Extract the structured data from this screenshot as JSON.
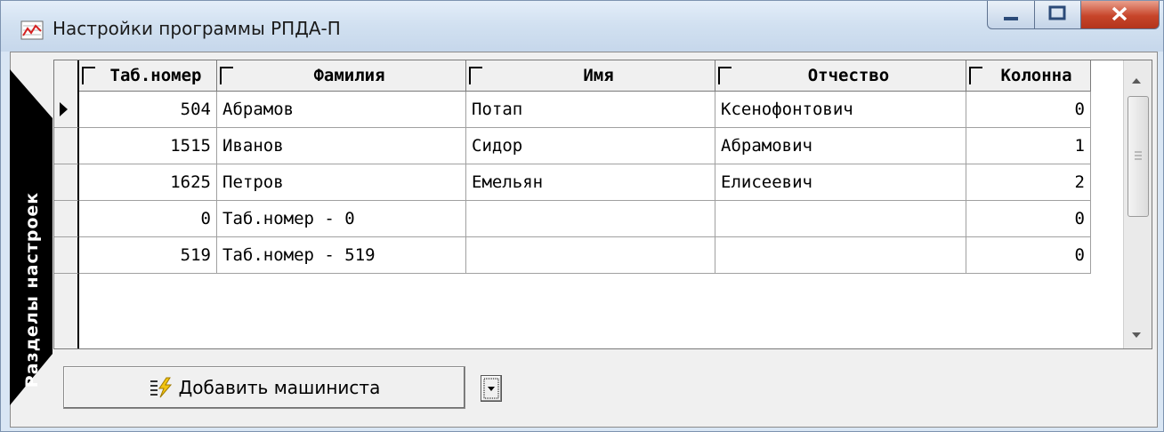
{
  "window": {
    "title": "Настройки программы РПДА-П"
  },
  "sidebar": {
    "label": "Разделы настроек"
  },
  "grid": {
    "columns": [
      "Таб.номер",
      "Фамилия",
      "Имя",
      "Отчество",
      "Колонна"
    ],
    "rows": [
      {
        "tab": "504",
        "surname": "Абрамов",
        "name": "Потап",
        "patronymic": "Ксенофонтович",
        "column": "0"
      },
      {
        "tab": "1515",
        "surname": "Иванов",
        "name": "Сидор",
        "patronymic": "Абрамович",
        "column": "1"
      },
      {
        "tab": "1625",
        "surname": "Петров",
        "name": "Емельян",
        "patronymic": "Елисеевич",
        "column": "2"
      },
      {
        "tab": "0",
        "surname": "Таб.номер - 0",
        "name": "",
        "patronymic": "",
        "column": "0"
      },
      {
        "tab": "519",
        "surname": "Таб.номер - 519",
        "name": "",
        "patronymic": "",
        "column": "0"
      }
    ]
  },
  "toolbar": {
    "add_driver_label": "Добавить машиниста"
  },
  "icons": {
    "app": "chart-icon",
    "add": "lightning-list-icon",
    "dropdown": "dropdown-arrow-icon",
    "minimize": "minimize-icon",
    "maximize": "maximize-icon",
    "close": "close-icon"
  },
  "colors": {
    "close_button": "#c7452a",
    "sidebar": "#000000",
    "titlebar": "#d2e1f1"
  }
}
